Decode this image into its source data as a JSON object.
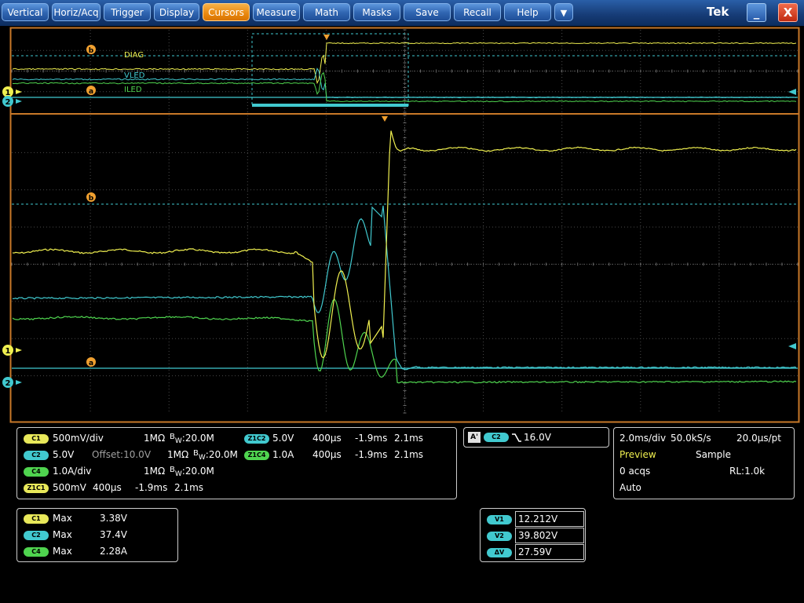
{
  "menu": {
    "items": [
      "Vertical",
      "Horiz/Acq",
      "Trigger",
      "Display",
      "Cursors",
      "Measure",
      "Math",
      "Masks",
      "Save",
      "Recall",
      "Help"
    ],
    "active": "Cursors",
    "dropdown_glyph": "▼",
    "brand": "Tek",
    "minimize_glyph": "_",
    "close_glyph": "X"
  },
  "colors": {
    "ch1": "#f0f050",
    "ch2": "#41c9cf",
    "ch4": "#4fd44f",
    "cursor": "#41c9cf",
    "marker": "#f0a030",
    "frame": "#c87828",
    "grid": "#5a5a5a"
  },
  "overview": {
    "labels": {
      "diag": "DIAG",
      "vled": "VLED",
      "iled": "ILED"
    },
    "cursor_b": "b",
    "cursor_a": "a",
    "ch1_marker": "1",
    "ch2_marker": "2"
  },
  "main": {
    "cursor_b": "b",
    "cursor_a": "a",
    "ch1_marker": "1",
    "ch2_marker": "2"
  },
  "channels_panel": {
    "rows": [
      {
        "badge": "C1",
        "scale": "500mV/div",
        "impedance": "1MΩ",
        "bw_prefix": "B",
        "bw_sub": "W",
        "bw": ":20.0M"
      },
      {
        "badge": "C2",
        "scale": "5.0V",
        "offset": "Offset:10.0V",
        "impedance": "1MΩ",
        "bw_prefix": "B",
        "bw_sub": "W",
        "bw": ":20.0M"
      },
      {
        "badge": "C4",
        "scale": "1.0A/div",
        "impedance": "1MΩ",
        "bw_prefix": "B",
        "bw_sub": "W",
        "bw": ":20.0M"
      }
    ],
    "z1c1": {
      "badge": "Z1C1",
      "scale": "500mV",
      "time": "400µs",
      "start": "-1.9ms",
      "end": "2.1ms"
    },
    "zooms": [
      {
        "badge": "Z1C2",
        "scale": "5.0V",
        "time": "400µs",
        "start": "-1.9ms",
        "end": "2.1ms"
      },
      {
        "badge": "Z1C4",
        "scale": "1.0A",
        "time": "400µs",
        "start": "-1.9ms",
        "end": "2.1ms"
      }
    ]
  },
  "trigger_panel": {
    "mode_badge": "A'",
    "source_badge": "C2",
    "slope_glyph": "⌐",
    "level": "16.0V"
  },
  "horizontal_panel": {
    "time_div": "2.0ms/div",
    "sample_rate": "50.0kS/s",
    "pt_time": "20.0µs/pt",
    "status": "Preview",
    "acq_mode": "Sample",
    "acqs": "0 acqs",
    "record_length": "RL:1.0k",
    "trigger_mode": "Auto"
  },
  "measurements": [
    {
      "badge": "C1",
      "type": "Max",
      "value": "3.38V"
    },
    {
      "badge": "C2",
      "type": "Max",
      "value": "37.4V"
    },
    {
      "badge": "C4",
      "type": "Max",
      "value": "2.28A"
    }
  ],
  "cursor_readout": [
    {
      "badge": "V1",
      "value": "12.212V"
    },
    {
      "badge": "V2",
      "value": "39.802V"
    },
    {
      "badge": "ΔV",
      "value": "27.59V"
    }
  ]
}
